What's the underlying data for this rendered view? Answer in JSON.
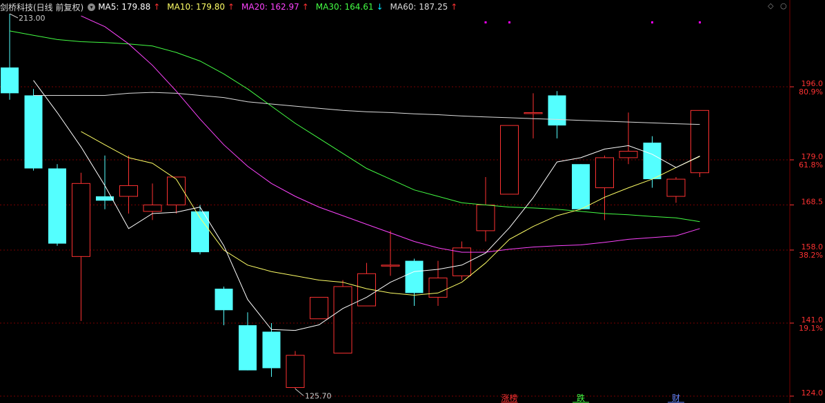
{
  "header": {
    "stock_title": "剑桥科技(日线 前复权)",
    "indicators": [
      {
        "label": "MA5: 179.88",
        "color": "#ffffff",
        "arrow": "↑",
        "dir": "up"
      },
      {
        "label": "MA10: 179.80",
        "color": "#ffff66",
        "arrow": "↑",
        "dir": "up"
      },
      {
        "label": "MA20: 162.97",
        "color": "#ff44ff",
        "arrow": "↑",
        "dir": "up"
      },
      {
        "label": "MA30: 164.61",
        "color": "#44ff44",
        "arrow": "↓",
        "dir": "down"
      },
      {
        "label": "MA60: 187.25",
        "color": "#dddddd",
        "arrow": "↑",
        "dir": "up"
      }
    ],
    "corner_icons": [
      "diamond-icon",
      "circle-icon"
    ]
  },
  "colors": {
    "up": "#ff3232",
    "down": "#54ffff",
    "grid": "#7a0000",
    "axis_text": "#ff3232",
    "ma5": "#ffffff",
    "ma10": "#ffff66",
    "ma20": "#ff44ff",
    "ma30": "#44ff44",
    "ma60": "#dddddd",
    "marker": "#ff00ff"
  },
  "chart_data": {
    "type": "candlestick",
    "ylim": [
      124.0,
      213.0
    ],
    "price_ticks": [
      {
        "price": "196.0",
        "pct": "80.9%"
      },
      {
        "price": "179.0",
        "pct": "61.8%"
      },
      {
        "price": "168.5",
        "pct": ""
      },
      {
        "price": "158.0",
        "pct": "38.2%"
      },
      {
        "price": "141.0",
        "pct": "19.1%"
      },
      {
        "price": "124.0",
        "pct": ""
      }
    ],
    "annotations": {
      "high": {
        "label": "213.00",
        "value": 213.0,
        "index": 0
      },
      "low": {
        "label": "125.70",
        "value": 125.7,
        "index": 12
      }
    },
    "candles": [
      {
        "o": 200.5,
        "c": 194.5,
        "h": 213.0,
        "l": 193.0
      },
      {
        "o": 194.0,
        "c": 177.0,
        "h": 195.5,
        "l": 176.5
      },
      {
        "o": 177.0,
        "c": 159.5,
        "h": 178.0,
        "l": 159.0
      },
      {
        "o": 156.5,
        "c": 173.5,
        "h": 176.0,
        "l": 141.5
      },
      {
        "o": 170.5,
        "c": 169.5,
        "h": 180.0,
        "l": 167.5
      },
      {
        "o": 170.5,
        "c": 173.0,
        "h": 180.0,
        "l": 166.5
      },
      {
        "o": 167.0,
        "c": 168.5,
        "h": 173.5,
        "l": 165.0
      },
      {
        "o": 168.5,
        "c": 175.0,
        "h": 175.0,
        "l": 166.5
      },
      {
        "o": 167.0,
        "c": 157.5,
        "h": 168.5,
        "l": 157.0
      },
      {
        "o": 149.0,
        "c": 144.0,
        "h": 149.5,
        "l": 140.5
      },
      {
        "o": 140.5,
        "c": 130.0,
        "h": 143.5,
        "l": 130.0
      },
      {
        "o": 139.0,
        "c": 130.5,
        "h": 141.0,
        "l": 128.5
      },
      {
        "o": 126.0,
        "c": 133.5,
        "h": 134.5,
        "l": 125.7
      },
      {
        "o": 142.0,
        "c": 147.0,
        "h": 147.0,
        "l": 142.0
      },
      {
        "o": 134.0,
        "c": 149.5,
        "h": 151.0,
        "l": 134.0
      },
      {
        "o": 145.0,
        "c": 152.5,
        "h": 155.0,
        "l": 145.0
      },
      {
        "o": 154.5,
        "c": 154.5,
        "h": 162.5,
        "l": 152.0
      },
      {
        "o": 155.5,
        "c": 148.0,
        "h": 156.0,
        "l": 145.0
      },
      {
        "o": 147.0,
        "c": 151.5,
        "h": 155.5,
        "l": 145.0
      },
      {
        "o": 152.0,
        "c": 158.5,
        "h": 160.0,
        "l": 151.0
      },
      {
        "o": 162.5,
        "c": 168.5,
        "h": 175.0,
        "l": 160.0
      },
      {
        "o": 171.0,
        "c": 187.0,
        "h": 187.0,
        "l": 171.0
      },
      {
        "o": 190.0,
        "c": 190.0,
        "h": 194.5,
        "l": 184.0
      },
      {
        "o": 194.0,
        "c": 187.0,
        "h": 195.0,
        "l": 184.0
      },
      {
        "o": 178.0,
        "c": 167.5,
        "h": 178.0,
        "l": 167.5
      },
      {
        "o": 172.5,
        "c": 179.5,
        "h": 180.0,
        "l": 165.0
      },
      {
        "o": 179.5,
        "c": 181.0,
        "h": 190.0,
        "l": 178.0
      },
      {
        "o": 183.0,
        "c": 174.5,
        "h": 184.5,
        "l": 172.5
      },
      {
        "o": 170.5,
        "c": 174.5,
        "h": 175.0,
        "l": 169.0
      },
      {
        "o": 176.0,
        "c": 190.5,
        "h": 190.5,
        "l": 175.0
      }
    ],
    "ma": {
      "ma5": [
        null,
        197.5,
        190.0,
        182.0,
        173.0,
        163.0,
        166.5,
        166.8,
        168.0,
        159.0,
        146.5,
        139.5,
        139.3,
        140.6,
        144.4,
        147.0,
        150.5,
        153.0,
        153.5,
        154.5,
        157.3,
        163.2,
        170.2,
        178.5,
        179.5,
        181.5,
        182.3,
        180.3,
        177.2,
        179.9
      ],
      "ma10": [
        null,
        null,
        null,
        185.6,
        182.5,
        179.5,
        178.2,
        174.5,
        165.5,
        158.0,
        154.5,
        153.0,
        152.0,
        151.0,
        150.5,
        149.0,
        148.0,
        147.5,
        148.0,
        150.5,
        155.0,
        160.5,
        163.5,
        166.0,
        167.5,
        170.3,
        172.5,
        174.5,
        177.2,
        179.8
      ],
      "ma20": [
        null,
        null,
        null,
        212.5,
        210.0,
        206.0,
        201.0,
        195.0,
        188.5,
        182.5,
        177.5,
        173.5,
        170.5,
        168.0,
        166.0,
        164.0,
        162.0,
        160.0,
        158.5,
        157.5,
        157.5,
        158.2,
        158.7,
        159.0,
        159.2,
        159.8,
        160.5,
        160.9,
        161.3,
        163.0
      ],
      "ma30": [
        209.0,
        208.0,
        207.0,
        206.5,
        206.3,
        206.0,
        205.5,
        204.0,
        202.0,
        199.0,
        195.5,
        191.5,
        187.5,
        184.0,
        180.5,
        177.0,
        174.5,
        172.0,
        170.5,
        169.0,
        168.5,
        168.0,
        167.8,
        167.5,
        167.0,
        166.5,
        166.2,
        165.8,
        165.5,
        164.6
      ],
      "ma60": [
        null,
        194.0,
        194.0,
        194.0,
        194.0,
        194.5,
        194.7,
        194.5,
        194.0,
        193.5,
        192.5,
        192.0,
        191.5,
        191.0,
        190.5,
        190.2,
        190.0,
        189.7,
        189.5,
        189.2,
        189.0,
        188.8,
        188.6,
        188.4,
        188.2,
        188.0,
        187.8,
        187.6,
        187.4,
        187.25
      ]
    },
    "markers": [
      {
        "index": 20,
        "value": 211.0
      },
      {
        "index": 21,
        "value": 211.0
      },
      {
        "index": 27,
        "value": 211.0
      },
      {
        "index": 29,
        "value": 211.0
      }
    ],
    "bottom_tags": [
      {
        "index": 21,
        "label": "涨榜",
        "color": "#ff3232"
      },
      {
        "index": 24,
        "label": "跌",
        "color": "#44ff44"
      },
      {
        "index": 28,
        "label": "财",
        "color": "#6688ff"
      }
    ]
  }
}
